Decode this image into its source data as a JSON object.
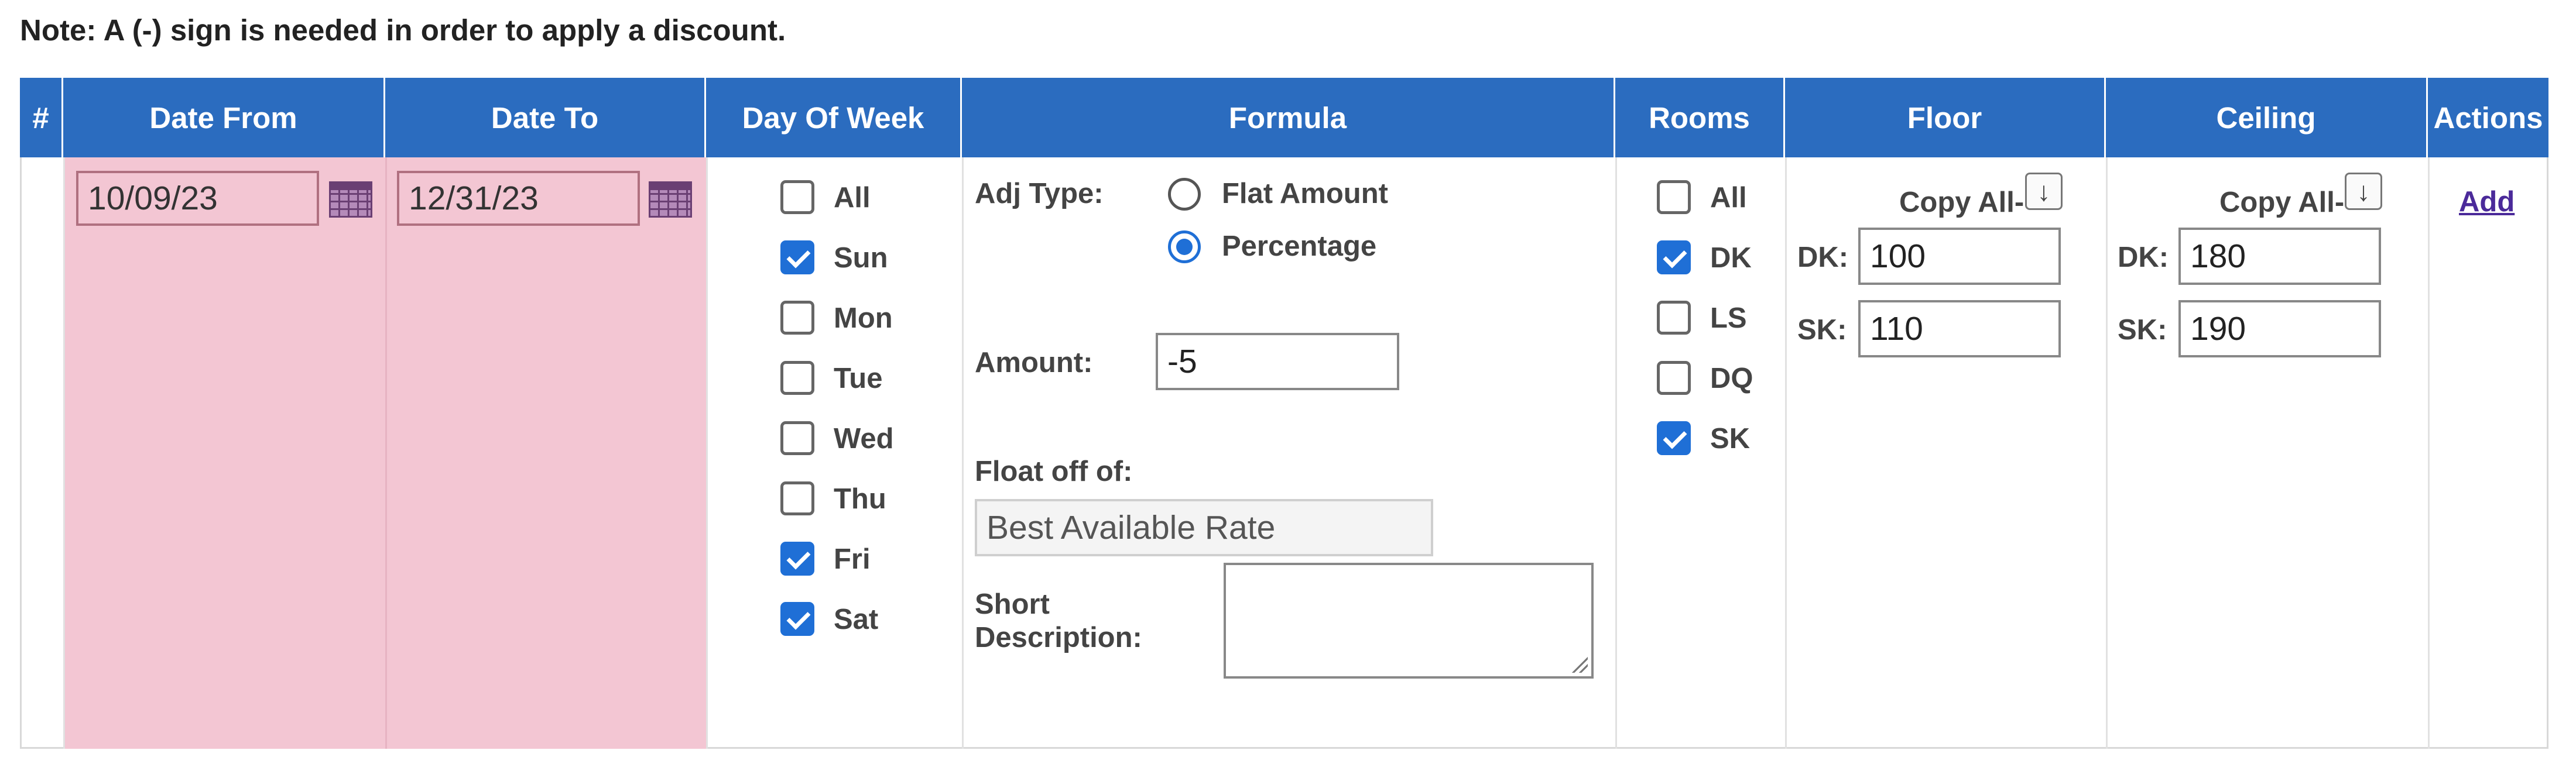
{
  "note": "Note: A (-) sign is needed in order to apply a discount.",
  "headers": {
    "num": "#",
    "date_from": "Date From",
    "date_to": "Date To",
    "day_of_week": "Day Of Week",
    "formula": "Formula",
    "rooms": "Rooms",
    "floor": "Floor",
    "ceiling": "Ceiling",
    "actions": "Actions"
  },
  "row": {
    "date_from": "10/09/23",
    "date_to": "12/31/23",
    "days": [
      {
        "label": "All",
        "checked": false
      },
      {
        "label": "Sun",
        "checked": true
      },
      {
        "label": "Mon",
        "checked": false
      },
      {
        "label": "Tue",
        "checked": false
      },
      {
        "label": "Wed",
        "checked": false
      },
      {
        "label": "Thu",
        "checked": false
      },
      {
        "label": "Fri",
        "checked": true
      },
      {
        "label": "Sat",
        "checked": true
      }
    ],
    "formula": {
      "adj_type_label": "Adj Type:",
      "options": [
        {
          "label": "Flat Amount",
          "selected": false
        },
        {
          "label": "Percentage",
          "selected": true
        }
      ],
      "amount_label": "Amount:",
      "amount": "-5",
      "float_label": "Float off of:",
      "float_value": "Best Available Rate",
      "short_desc_label": "Short Description:",
      "short_desc_value": ""
    },
    "rooms": [
      {
        "label": "All",
        "checked": false
      },
      {
        "label": "DK",
        "checked": true
      },
      {
        "label": "LS",
        "checked": false
      },
      {
        "label": "DQ",
        "checked": false
      },
      {
        "label": "SK",
        "checked": true
      }
    ],
    "floor": {
      "copy_all_label": "Copy All-",
      "dk_label": "DK:",
      "dk_value": "100",
      "sk_label": "SK:",
      "sk_value": "110"
    },
    "ceiling": {
      "copy_all_label": "Copy All-",
      "dk_label": "DK:",
      "dk_value": "180",
      "sk_label": "SK:",
      "sk_value": "190"
    },
    "action_add": "Add"
  },
  "icons": {
    "calendar": "calendar-icon",
    "copy_down": "arrow-down-icon"
  },
  "colors": {
    "header_bg": "#2b6cbf",
    "date_cell_bg": "#f3c6d3",
    "checkbox_checked": "#1f6fd6",
    "link": "#4b2a9a"
  }
}
